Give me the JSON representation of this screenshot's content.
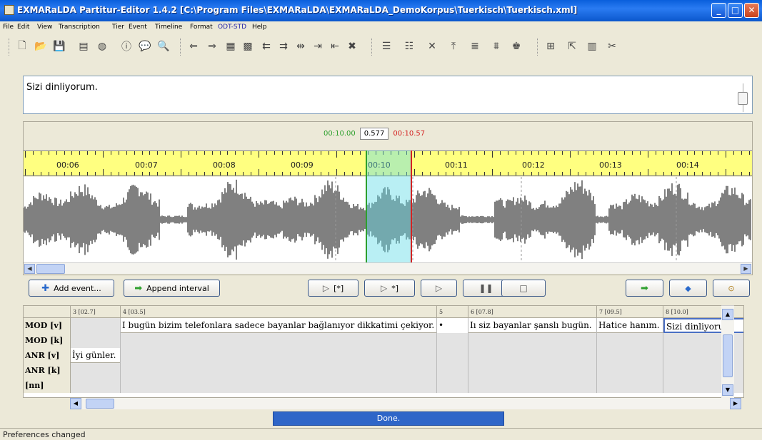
{
  "window": {
    "title": "EXMARaLDA Partitur-Editor 1.4.2 [C:\\Program Files\\EXMARaLDA\\EXMARaLDA_DemoKorpus\\Tuerkisch\\Tuerkisch.xml]"
  },
  "menu": [
    "File",
    "Edit",
    "View",
    "Transcription",
    "Tier",
    "Event",
    "Timeline",
    "Format",
    "ODT-STD",
    "Help"
  ],
  "toolbar_icons": [
    "new-document-icon",
    "open-folder-icon",
    "save-icon",
    "transcription-icon",
    "globe-icon",
    "info-icon",
    "speech-bubble-icon",
    "search-icon",
    "text-left-icon",
    "text-right-icon",
    "grid-icon",
    "merge-icon",
    "shift-left-icon",
    "shift-right-icon",
    "split-icon",
    "move-right-icon",
    "move-left-icon",
    "delete-icon",
    "insert-tier-icon",
    "tier-properties-icon",
    "tier-remove-icon",
    "upload-icon",
    "stack-icon",
    "collapse-icon",
    "speaker-icon",
    "align-icon",
    "export-icon",
    "columns-icon",
    "cut-icon"
  ],
  "text_display": "Sizi dinliyorum.",
  "selection": {
    "start": "00:10.00",
    "length": "0.577",
    "end": "00:10.57"
  },
  "timeline": {
    "labels": [
      "00:06",
      "00:07",
      "00:08",
      "00:09",
      "00:10",
      "00:11",
      "00:12",
      "00:13",
      "00:14"
    ]
  },
  "buttons": {
    "add_event": "Add event...",
    "append_interval": "Append interval",
    "play_start": "[*]",
    "play_end": "*]"
  },
  "partitur": {
    "columns": [
      "3 [02.7]",
      "4 [03.5]",
      "5",
      "6 [07.8]",
      "7 [09.5]",
      "8 [10.0]"
    ],
    "tiers": [
      "MOD [v]",
      "MOD [k]",
      "ANR [v]",
      "ANR [k]",
      "[nn]"
    ],
    "mod_v": {
      "c4": "I bugün bizim telefonlara sadece bayanlar bağlanıyor dikkatimi çekiyor.",
      "c5": "•",
      "c6": "Iı siz bayanlar şanslı bugün.",
      "c7": "Hatice hanım.",
      "c8": "Sizi dinliyorum."
    },
    "anr_v": {
      "c3": "İyi günler."
    }
  },
  "progress_text": "Done.",
  "status": "Preferences changed",
  "colors": {
    "titlebar": "#0a5fdc",
    "ruler": "#ffff80",
    "selection_start": "#2ea02e",
    "selection_end": "#d42222",
    "selection_fill": "#64dce6",
    "progress": "#2f66c8"
  }
}
